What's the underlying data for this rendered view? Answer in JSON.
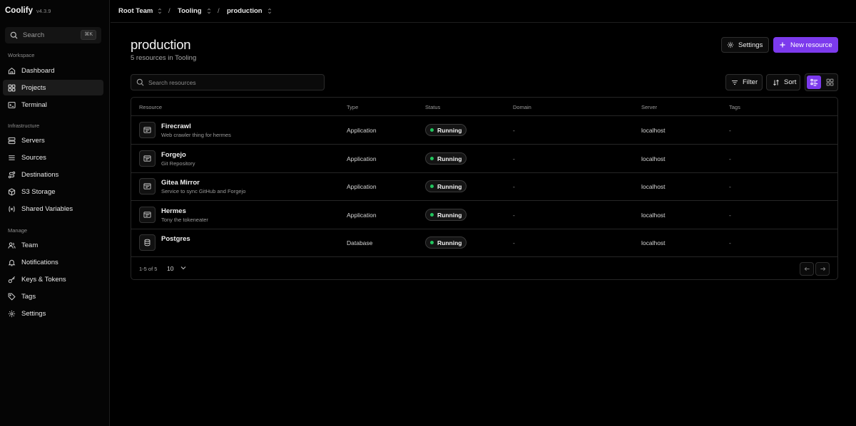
{
  "app": {
    "name": "Coolify",
    "version": "v4.3.9"
  },
  "sidebar": {
    "search_label": "Search",
    "search_shortcut": "⌘K",
    "sections": {
      "workspace": "Workspace",
      "infrastructure": "Infrastructure",
      "manage": "Manage"
    },
    "items": [
      {
        "label": "Dashboard",
        "icon": "home-icon"
      },
      {
        "label": "Projects",
        "icon": "grid-icon",
        "active": true
      },
      {
        "label": "Terminal",
        "icon": "terminal-icon"
      },
      {
        "label": "Servers",
        "icon": "server-icon"
      },
      {
        "label": "Sources",
        "icon": "git-branch-icon"
      },
      {
        "label": "Destinations",
        "icon": "route-icon"
      },
      {
        "label": "S3 Storage",
        "icon": "box-icon"
      },
      {
        "label": "Shared Variables",
        "icon": "variable-icon"
      },
      {
        "label": "Team",
        "icon": "users-icon"
      },
      {
        "label": "Notifications",
        "icon": "bell-icon"
      },
      {
        "label": "Keys & Tokens",
        "icon": "key-icon"
      },
      {
        "label": "Tags",
        "icon": "tag-icon"
      },
      {
        "label": "Settings",
        "icon": "gear-icon"
      }
    ]
  },
  "breadcrumb": {
    "team": "Root Team",
    "project": "Tooling",
    "environment": "production",
    "separator": "/"
  },
  "header": {
    "title": "production",
    "subtitle": "5 resources in Tooling",
    "settings_label": "Settings",
    "new_resource_label": "New resource"
  },
  "toolbar": {
    "search_placeholder": "Search resources",
    "filter_label": "Filter",
    "sort_label": "Sort",
    "view_mode": "list"
  },
  "table": {
    "columns": [
      "Resource",
      "Type",
      "Status",
      "Domain",
      "Server",
      "Tags"
    ],
    "rows": [
      {
        "name": "Firecrawl",
        "description": "Web crawler thing for hermes",
        "type": "Application",
        "status": "Running",
        "domain": "-",
        "server": "localhost",
        "tags": "-",
        "icon": "app-window-icon"
      },
      {
        "name": "Forgejo",
        "description": "Git Repository",
        "type": "Application",
        "status": "Running",
        "domain": "-",
        "server": "localhost",
        "tags": "-",
        "icon": "app-window-icon"
      },
      {
        "name": "Gitea Mirror",
        "description": "Service to sync GitHub and Forgejo",
        "type": "Application",
        "status": "Running",
        "domain": "-",
        "server": "localhost",
        "tags": "-",
        "icon": "app-window-icon"
      },
      {
        "name": "Hermes",
        "description": "Tony the tokeneater",
        "type": "Application",
        "status": "Running",
        "domain": "-",
        "server": "localhost",
        "tags": "-",
        "icon": "app-window-icon"
      },
      {
        "name": "Postgres",
        "description": "",
        "type": "Database",
        "status": "Running",
        "domain": "-",
        "server": "localhost",
        "tags": "-",
        "icon": "database-icon"
      }
    ],
    "footer": {
      "range": "1-5 of 5",
      "per_page": "10"
    }
  },
  "colors": {
    "accent": "#7c3aed",
    "running": "#22c55e",
    "background": "#000000"
  }
}
